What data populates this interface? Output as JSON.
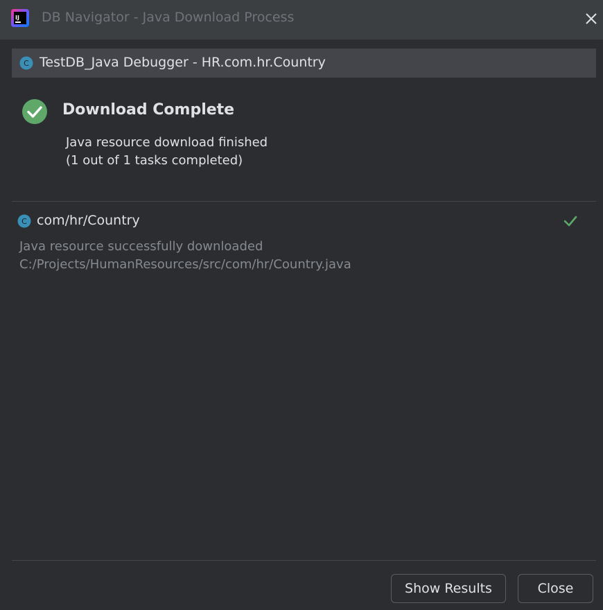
{
  "window": {
    "title": "DB Navigator - Java Download Process",
    "app_icon": "intellij-idea-icon",
    "close_icon": "close-icon"
  },
  "source": {
    "icon": "class-c-icon",
    "label": "TestDB_Java Debugger - HR.com.hr.Country"
  },
  "status": {
    "icon": "success-check-circle-icon",
    "title": "Download Complete",
    "message": "Java resource download finished",
    "progress_text": "(1 out of 1 tasks completed)",
    "tasks_completed": 1,
    "tasks_total": 1
  },
  "tasks": [
    {
      "icon": "class-c-icon",
      "name": "com/hr/Country",
      "status_icon": "check-icon",
      "message": "Java resource successfully downloaded",
      "path": "C:/Projects/HumanResources/src/com/hr/Country.java"
    }
  ],
  "buttons": {
    "show_results": "Show Results",
    "close": "Close"
  },
  "colors": {
    "success": "#5fa86a",
    "class_icon": "#3a8fb7",
    "background": "#2b2d30",
    "titlebar": "#3c3f41"
  }
}
